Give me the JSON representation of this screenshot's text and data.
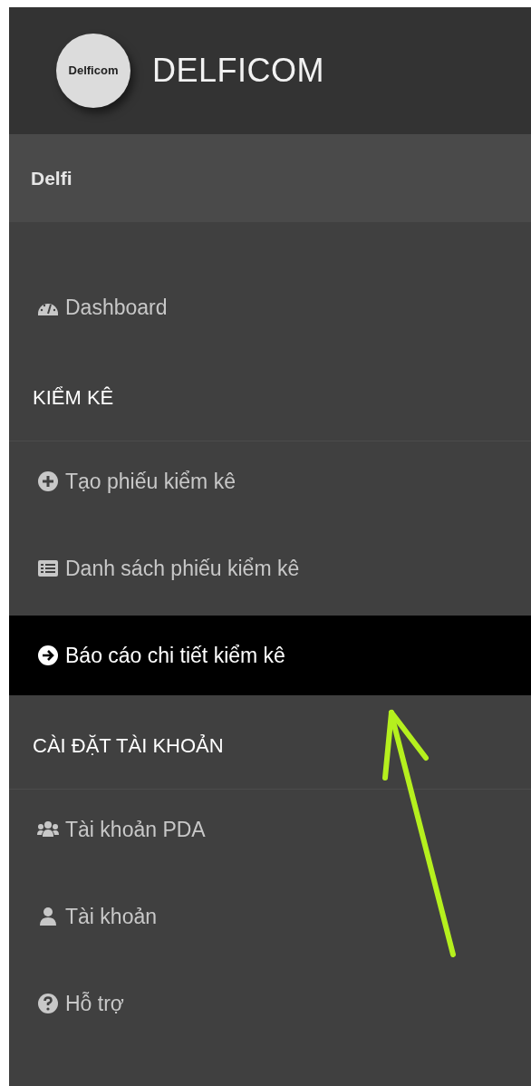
{
  "header": {
    "logo_text": "Delficom",
    "title": "DELFICOM"
  },
  "user": {
    "name": "Delfi"
  },
  "menu": [
    {
      "kind": "item",
      "label": "Dashboard",
      "selected": false
    },
    {
      "kind": "heading",
      "label": "KIỂM KÊ"
    },
    {
      "kind": "item",
      "label": "Tạo phiếu kiểm kê",
      "selected": false
    },
    {
      "kind": "item",
      "label": "Danh sách phiếu kiểm kê",
      "selected": false
    },
    {
      "kind": "item",
      "label": "Báo cáo chi tiết kiểm kê",
      "selected": true
    },
    {
      "kind": "heading",
      "label": "CÀI ĐẶT TÀI KHOẢN"
    },
    {
      "kind": "item",
      "label": "Tài khoản PDA",
      "selected": false
    },
    {
      "kind": "item",
      "label": "Tài khoản",
      "selected": false
    },
    {
      "kind": "item",
      "label": "Hỗ trợ",
      "selected": false
    }
  ]
}
